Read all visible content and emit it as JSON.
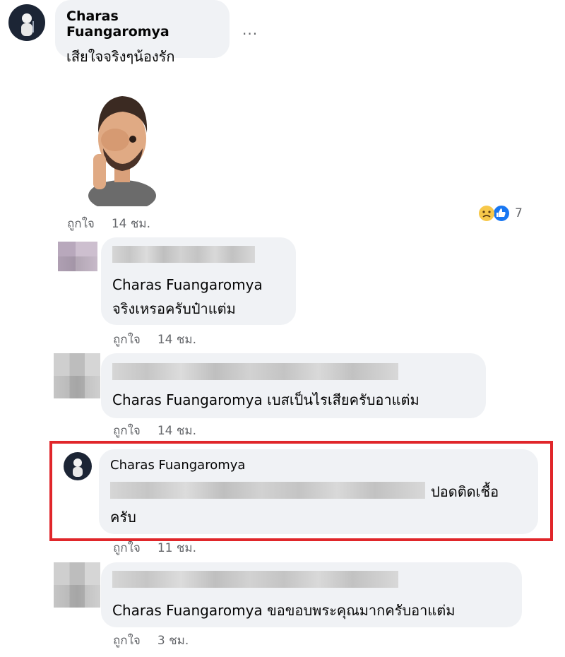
{
  "comments": [
    {
      "author": "Charas Fuangaromya",
      "text": "เสียใจจริงๆน้องรัก",
      "more": "...",
      "like": "ถูกใจ",
      "time": "14 ชม.",
      "reaction_count": "7"
    },
    {
      "mention": "Charas Fuangaromya",
      "text": "จริงเหรอครับป๋าแต่ม",
      "like": "ถูกใจ",
      "time": "14 ชม."
    },
    {
      "mention": "Charas Fuangaromya",
      "text": "เบสเป็นไรเสียครับอาแต่ม",
      "like": "ถูกใจ",
      "time": "14 ชม."
    },
    {
      "author": "Charas Fuangaromya",
      "text_end": "ปอดติดเชื้อ",
      "text_wrap": "ครับ",
      "like": "ถูกใจ",
      "time": "11 ชม."
    },
    {
      "mention": "Charas Fuangaromya",
      "text": "ขอขอบพระคุณมากครับอาแต่ม",
      "like": "ถูกใจ",
      "time": "3 ชม."
    }
  ],
  "colors": {
    "bubble": "#f0f2f5",
    "highlight": "#e0262a",
    "meta": "#65676b"
  },
  "icons": [
    "sad-reaction-icon",
    "like-reaction-icon",
    "facepalm-avatar-sticker",
    "more-options-icon"
  ]
}
